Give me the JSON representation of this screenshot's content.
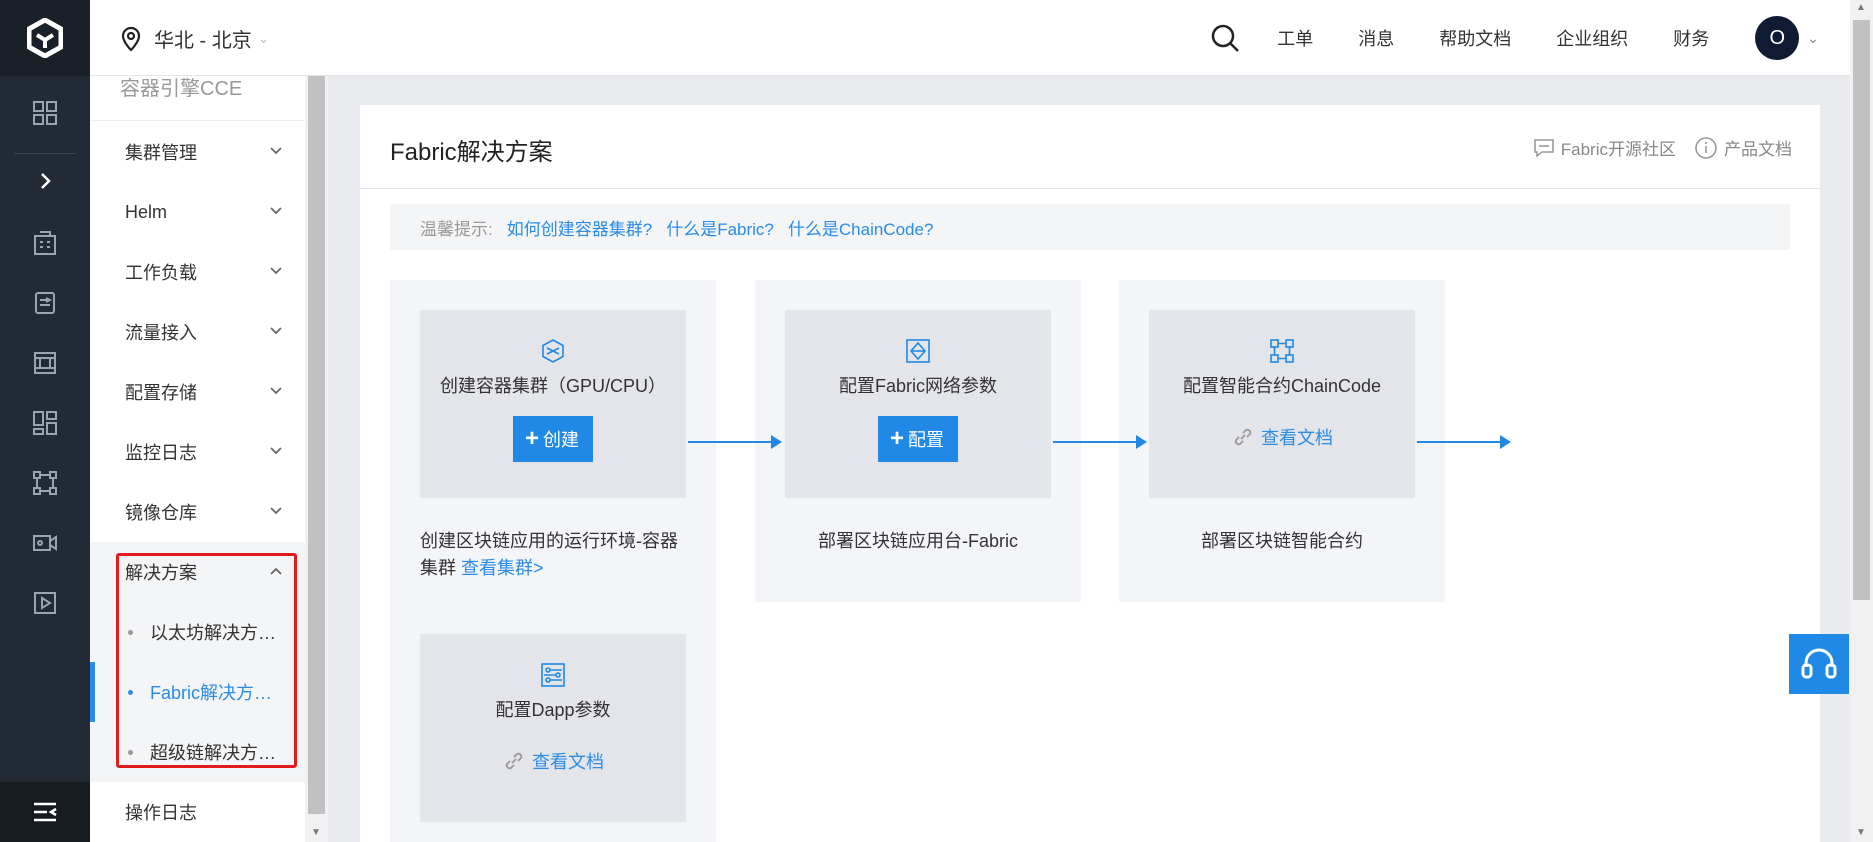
{
  "header": {
    "region": "华北 - 北京",
    "nav": [
      "工单",
      "消息",
      "帮助文档",
      "企业组织",
      "财务"
    ],
    "avatar_letter": "O"
  },
  "rail": {
    "icons": [
      "grid-icon",
      "chevron-right-icon",
      "building-icon",
      "database-icon",
      "server-icon",
      "dashboard-icon",
      "network-icon",
      "video-icon",
      "play-icon"
    ]
  },
  "sidebar": {
    "product": "容器引擎CCE",
    "items": [
      {
        "label": "集群管理"
      },
      {
        "label": "Helm"
      },
      {
        "label": "工作负载"
      },
      {
        "label": "流量接入"
      },
      {
        "label": "配置存储"
      },
      {
        "label": "监控日志"
      },
      {
        "label": "镜像仓库"
      },
      {
        "label": "解决方案"
      }
    ],
    "sub_items": [
      {
        "label": "以太坊解决方…"
      },
      {
        "label": "Fabric解决方…"
      },
      {
        "label": "超级链解决方…"
      }
    ],
    "footer_item": "操作日志"
  },
  "main": {
    "title": "Fabric解决方案",
    "links": {
      "community": "Fabric开源社区",
      "docs": "产品文档"
    },
    "tip": {
      "label": "温馨提示:",
      "links": [
        "如何创建容器集群?",
        "什么是Fabric?",
        "什么是ChainCode?"
      ]
    },
    "steps": [
      {
        "title": "创建容器集群（GPU/CPU）",
        "button": "创建",
        "desc": "创建区块链应用的运行环境-容器集群",
        "desc_link": "查看集群>"
      },
      {
        "title": "配置Fabric网络参数",
        "button": "配置",
        "desc": "部署区块链应用台-Fabric"
      },
      {
        "title": "配置智能合约ChainCode",
        "link": "查看文档",
        "desc": "部署区块链智能合约"
      },
      {
        "title": "配置Dapp参数",
        "link": "查看文档"
      }
    ]
  },
  "colors": {
    "accent": "#1f89e5",
    "rail": "#222a35",
    "highlight": "#e21d1d"
  }
}
